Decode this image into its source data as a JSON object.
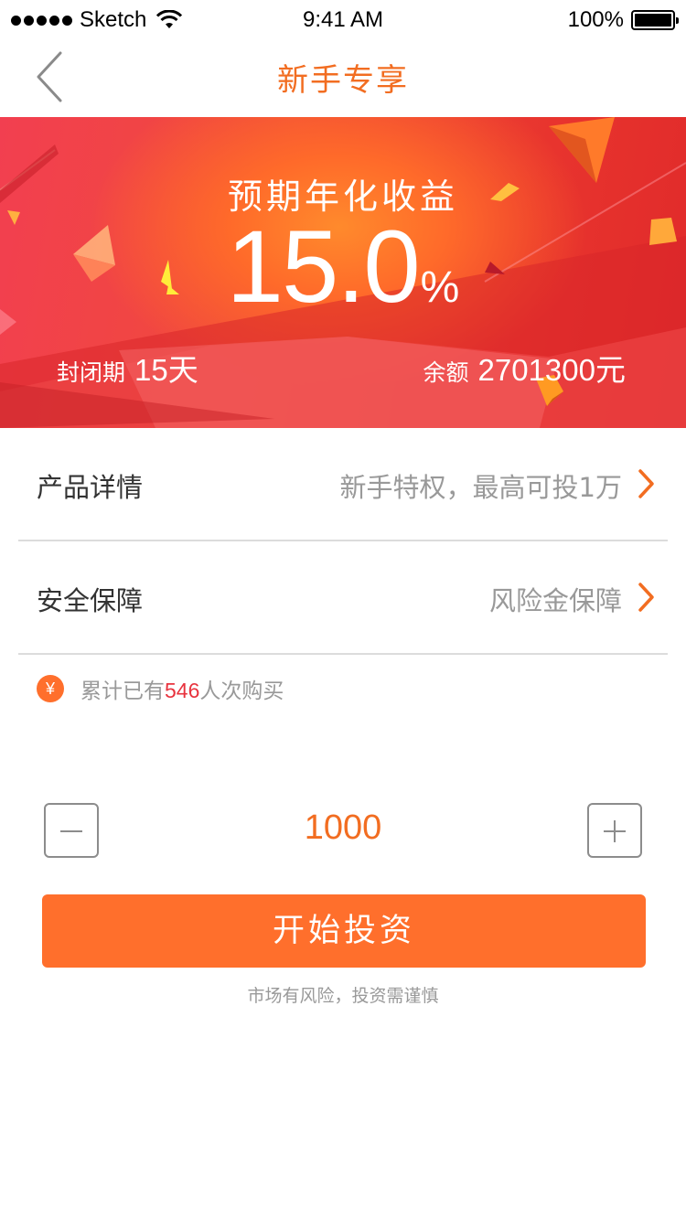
{
  "status_bar": {
    "carrier": "Sketch",
    "time": "9:41 AM",
    "battery": "100%"
  },
  "nav": {
    "title": "新手专享",
    "back_icon": "chevron-left-icon"
  },
  "banner": {
    "label": "预期年化收益",
    "rate": "15.0",
    "rate_unit": "%",
    "term_label": "封闭期",
    "term_number": "15",
    "term_unit": "天",
    "balance_label": "余额",
    "balance_number": "2701300",
    "balance_unit": "元"
  },
  "rows": [
    {
      "label": "产品详情",
      "value": "新手特权，最高可投1万",
      "icon": "chevron-right-icon"
    },
    {
      "label": "安全保障",
      "value": "风险金保障",
      "icon": "chevron-right-icon"
    }
  ],
  "purchase": {
    "icon_glyph": "¥",
    "prefix": "累计已有",
    "count": "546",
    "suffix": "人次购买"
  },
  "stepper": {
    "amount": "1000"
  },
  "cta": {
    "label": "开始投资",
    "risk_note": "市场有风险，投资需谨慎"
  },
  "colors": {
    "accent": "#f26d21",
    "button": "#ff6f2c",
    "highlight": "#e8333e",
    "muted": "#999999"
  }
}
